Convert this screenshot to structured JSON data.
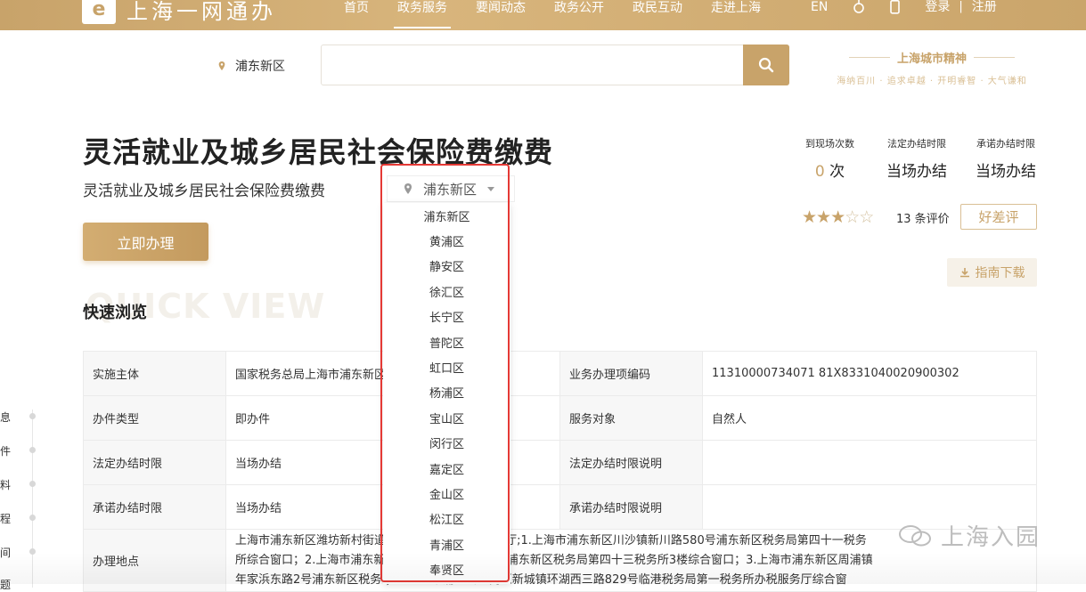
{
  "header": {
    "logo_text": "上海一网通办",
    "nav": [
      "首页",
      "政务服务",
      "要闻动态",
      "政务公开",
      "政民互动",
      "走进上海"
    ],
    "lang": "EN",
    "login": "登录",
    "divider": "|",
    "register": "注册"
  },
  "search": {
    "location": "浦东新区",
    "placeholder": ""
  },
  "spirit": {
    "title": "上海城市精神",
    "subtitle": "海纳百川 · 追求卓越 · 开明睿智 · 大气谦和"
  },
  "service": {
    "title": "灵活就业及城乡居民社会保险费缴费",
    "subtitle": "灵活就业及城乡居民社会保险费缴费",
    "district": "浦东新区",
    "apply_label": "立即办理"
  },
  "stats": [
    {
      "label": "到现场次数",
      "num": "0",
      "unit": " 次"
    },
    {
      "label": "法定办结时限",
      "value": "当场办结"
    },
    {
      "label": "承诺办结时限",
      "value": "当场办结"
    }
  ],
  "rating": {
    "stars_filled": 3,
    "stars_total": 5,
    "reviews": "13 条评价",
    "rate_label": "好差评"
  },
  "guide_label": "指南下载",
  "quick_view": {
    "bg_text": "QUICK VIEW",
    "title": "快速浏览"
  },
  "table": {
    "rows": [
      {
        "k1": "实施主体",
        "v1": "国家税务总局上海市浦东新区",
        "k2": "业务办理项编码",
        "v2": "11310000734071 81X8331040020900302"
      },
      {
        "k1": "办件类型",
        "v1": "即办件",
        "k2": "服务对象",
        "v2": "自然人"
      },
      {
        "k1": "法定办结时限",
        "v1": "当场办结",
        "k2": "法定办结时限说明",
        "v2": ""
      },
      {
        "k1": "承诺办结时限",
        "v1": "当场办结",
        "k2": "承诺办结时限说明",
        "v2": ""
      }
    ],
    "address_key": "办理地点",
    "address_line1": "上海市浦东新区潍坊新村街道 局第一税务所办税服务厅;1.上海市浦东新区川沙镇新川路580号浦东新区税务局第四十一税务",
    "address_line2": "所综合窗口；2.上海市浦东新 丹桂路1059号）3号楼浦东新区税务局第四十三税务所3楼综合窗口；3.上海市浦东新区周浦镇",
    "address_line3": "年家浜东路2号浦东新区税务 ；4.上海市浦东新区南汇新城镇环湖西三路829号临港税务局第一税务所办税服务厅综合窗"
  },
  "sidenav": [
    "息",
    "件",
    "料",
    "程",
    "间",
    "题"
  ],
  "dropdown": [
    "浦东新区",
    "黄浦区",
    "静安区",
    "徐汇区",
    "长宁区",
    "普陀区",
    "虹口区",
    "杨浦区",
    "宝山区",
    "闵行区",
    "嘉定区",
    "金山区",
    "松江区",
    "青浦区",
    "奉贤区"
  ],
  "watermark": "上海入园",
  "colors": {
    "gold": "#c8a36a",
    "highlight": "#e53935"
  }
}
